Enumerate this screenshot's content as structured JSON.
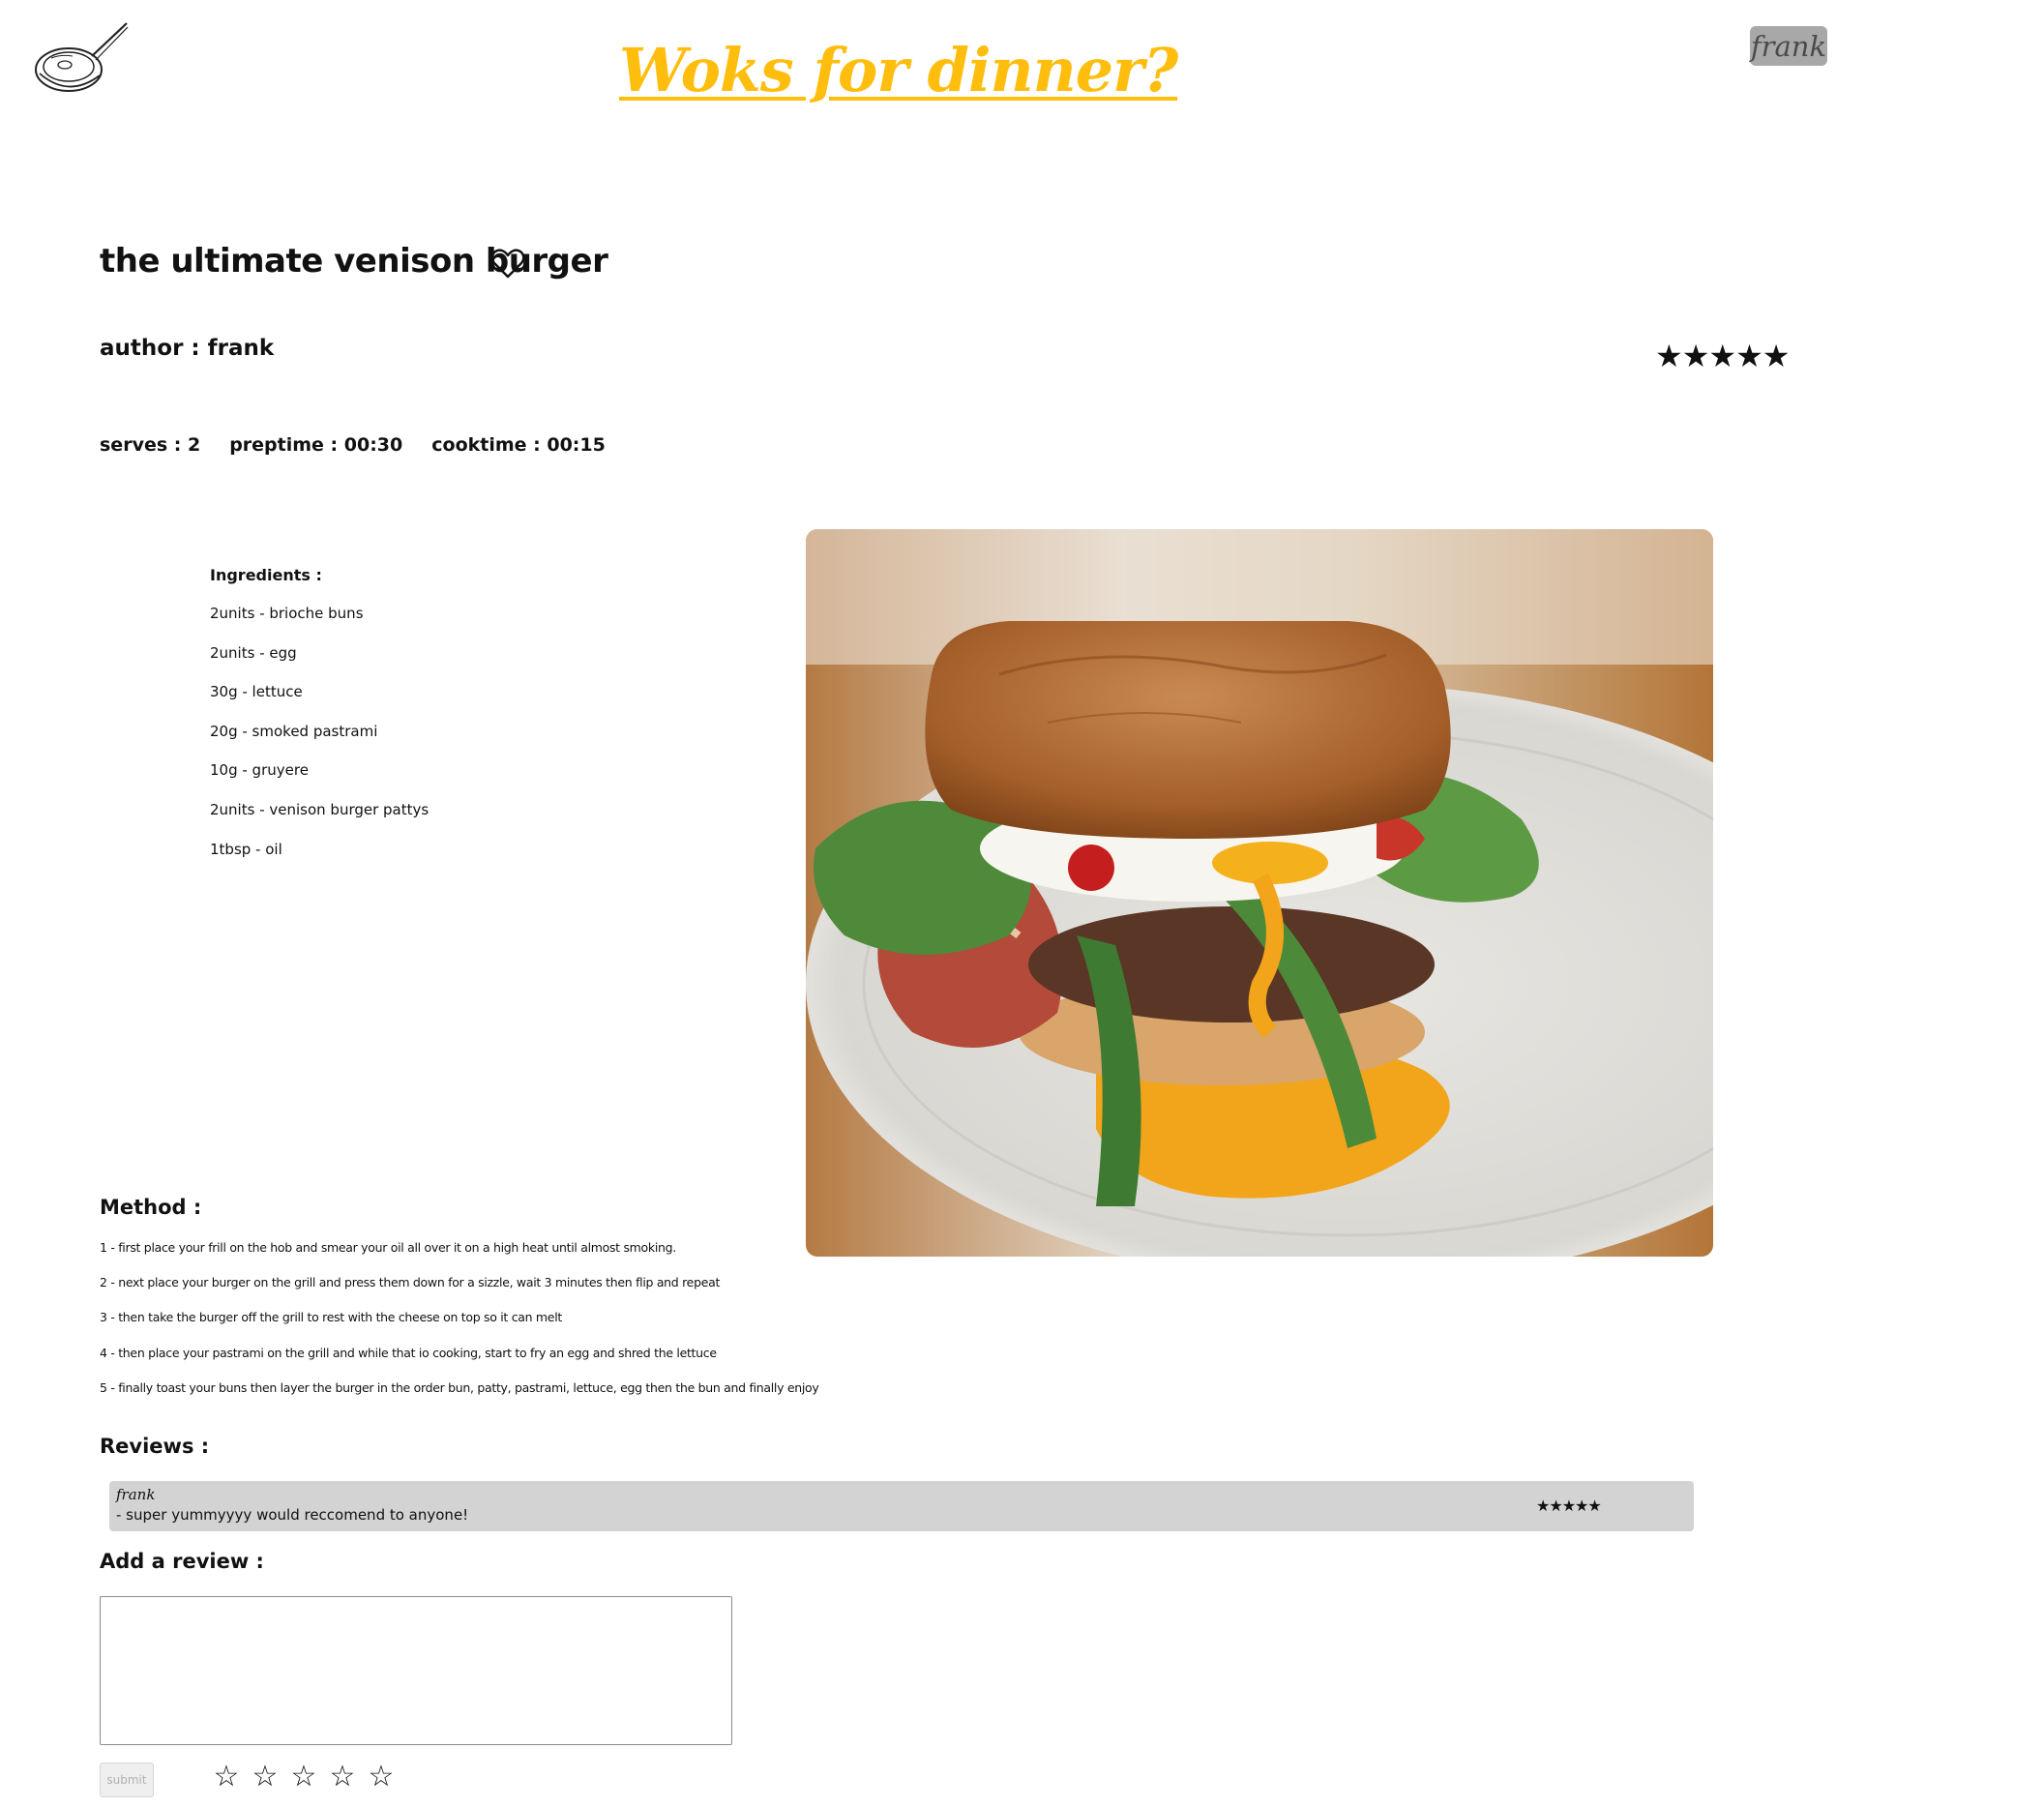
{
  "header": {
    "site_title": "Woks for dinner?",
    "user_name": "frank",
    "title_color": "#ffbe0d",
    "logo_icon": "wok-icon"
  },
  "recipe": {
    "title": "the ultimate venison burger",
    "favorite_icon": "heart-outline-icon",
    "author_line": "author : frank",
    "rating_text": "★★★★★",
    "rating_value": 5,
    "serves": "serves : 2",
    "preptime": "preptime : 00:30",
    "cooktime": "cooktime : 00:15",
    "ingredients_heading": "Ingredients :",
    "ingredients": [
      "2units - brioche buns",
      "2units - egg",
      "30g - lettuce",
      "20g - smoked pastrami",
      "10g - gruyere",
      "2units - venison burger pattys",
      "1tbsp - oil"
    ],
    "method_heading": "Method :",
    "method": [
      "1 - first place your frill on the hob and smear your oil all over it on a high heat until almost smoking.",
      "2 - next place your burger on the grill and press them down for a sizzle, wait 3 minutes then flip and repeat",
      "3 - then take the burger off the grill to rest with the cheese on top so it can melt",
      "4 - then place your pastrami on the grill and while that io cooking, start to fry an egg and shred the lettuce",
      "5 - finally toast your buns then layer the burger in the order bun, patty, pastrami, lettuce, egg then the bun and finally enjoy"
    ],
    "photo_subject": "burger-photo"
  },
  "reviews": {
    "heading": "Reviews :",
    "items": [
      {
        "author": "frank",
        "text": "- super yummyyyy would reccomend to anyone!",
        "stars_text": "★★★★★",
        "rating": 5
      }
    ]
  },
  "add_review": {
    "heading": "Add a review :",
    "input_value": "",
    "submit_label": "submit",
    "star_glyphs": [
      "☆",
      "☆",
      "☆",
      "☆",
      "☆"
    ],
    "selected_rating": 0
  }
}
